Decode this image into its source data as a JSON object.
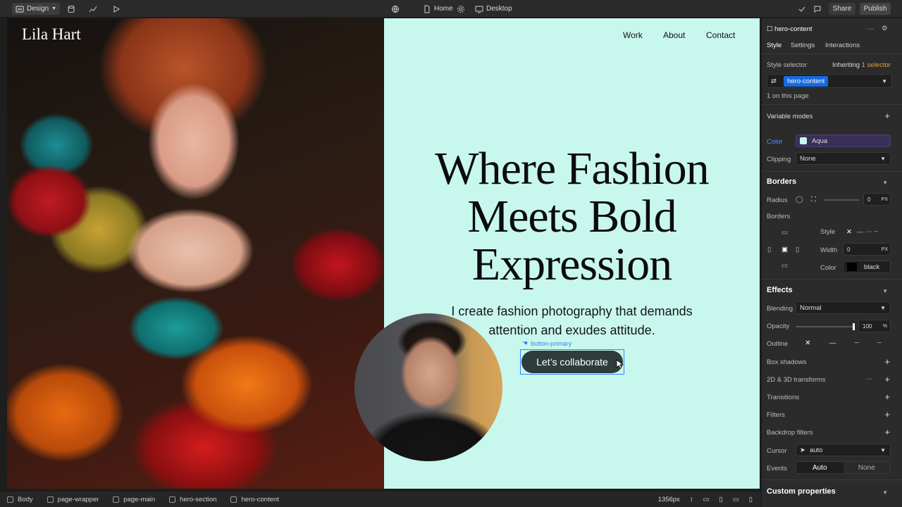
{
  "topbar": {
    "mode_label": "Design",
    "page_label": "Home",
    "breakpoint_label": "Desktop",
    "share_label": "Share",
    "publish_label": "Publish"
  },
  "canvas": {
    "photo_brand": "Lila Hart",
    "nav": [
      "Work",
      "About",
      "Contact"
    ],
    "headline_lines": [
      "Where Fashion",
      "Meets Bold",
      "Expression"
    ],
    "subtext": "I create fashion photography that demands attention and exudes attitude.",
    "button_tag": "button-primary",
    "button_label": "Let’s collaborate",
    "hero_bg_color": "#c8f7ee"
  },
  "breadcrumb": {
    "items": [
      "Body",
      "page-wrapper",
      "page-main",
      "hero-section",
      "hero-content"
    ],
    "width_label": "1356px"
  },
  "panel": {
    "element_name": "hero-content",
    "tabs": [
      "Style",
      "Settings",
      "Interactions"
    ],
    "style_selector_label": "Style selector",
    "inheriting_label": "Inheriting",
    "inheriting_count": "1 selector",
    "class_chip": "hero-content",
    "on_page_label": "1 on this page",
    "variable_modes_label": "Variable modes",
    "color_label": "Color",
    "color_value": "Aqua",
    "clipping_label": "Clipping",
    "clipping_value": "None",
    "borders_title": "Borders",
    "radius_label": "Radius",
    "radius_value": "0",
    "radius_unit": "PX",
    "borders_label": "Borders",
    "style_label": "Style",
    "width_label": "Width",
    "width_value": "0",
    "width_unit": "PX",
    "border_color_label": "Color",
    "border_color_value": "black",
    "effects_title": "Effects",
    "blending_label": "Blending",
    "blending_value": "Normal",
    "opacity_label": "Opacity",
    "opacity_value": "100",
    "opacity_unit": "%",
    "outline_label": "Outline",
    "rows": [
      "Box shadows",
      "2D & 3D transforms",
      "Transitions",
      "Filters",
      "Backdrop filters"
    ],
    "cursor_label": "Cursor",
    "cursor_value": "auto",
    "events_label": "Events",
    "events_options": [
      "Auto",
      "None"
    ],
    "custom_props_title": "Custom properties",
    "accent_color": "#1769e0",
    "aqua_swatch": "#c8f7ee"
  }
}
